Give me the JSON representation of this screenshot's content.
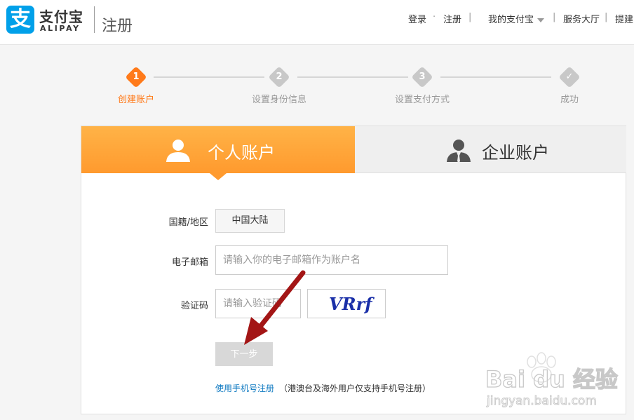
{
  "header": {
    "logo_char": "支",
    "logo_cn": "支付宝",
    "logo_en": "ALIPAY",
    "page_title": "注册",
    "nav": {
      "login": "登录",
      "dot": "·",
      "register": "注册",
      "sep": "|",
      "my_alipay": "我的支付宝",
      "service_hall": "服务大厅",
      "more": "提建"
    }
  },
  "steps": [
    {
      "num": "1",
      "label": "创建账户",
      "state": "active"
    },
    {
      "num": "2",
      "label": "设置身份信息",
      "state": "pending"
    },
    {
      "num": "3",
      "label": "设置支付方式",
      "state": "pending"
    },
    {
      "num": "✓",
      "label": "成功",
      "state": "pending"
    }
  ],
  "tabs": {
    "personal": "个人账户",
    "company": "企业账户"
  },
  "form": {
    "country_label": "国籍/地区",
    "country_value": "中国大陆",
    "email_label": "电子邮箱",
    "email_placeholder": "请输入你的电子邮箱作为账户名",
    "captcha_label": "验证码",
    "captcha_placeholder": "请输入验证码",
    "captcha_text": "VRrf",
    "next_button": "下一步",
    "phone_link": "使用手机号注册",
    "phone_note": "（港澳台及海外用户仅支持手机号注册）"
  },
  "watermark": {
    "brand": "Bai du 经验",
    "url": "jingyan.baidu.com"
  },
  "colors": {
    "brand_blue": "#00a0e9",
    "accent_orange": "#ff7a1a",
    "link_blue": "#0e79c1",
    "annotation_arrow": "#a31515"
  }
}
